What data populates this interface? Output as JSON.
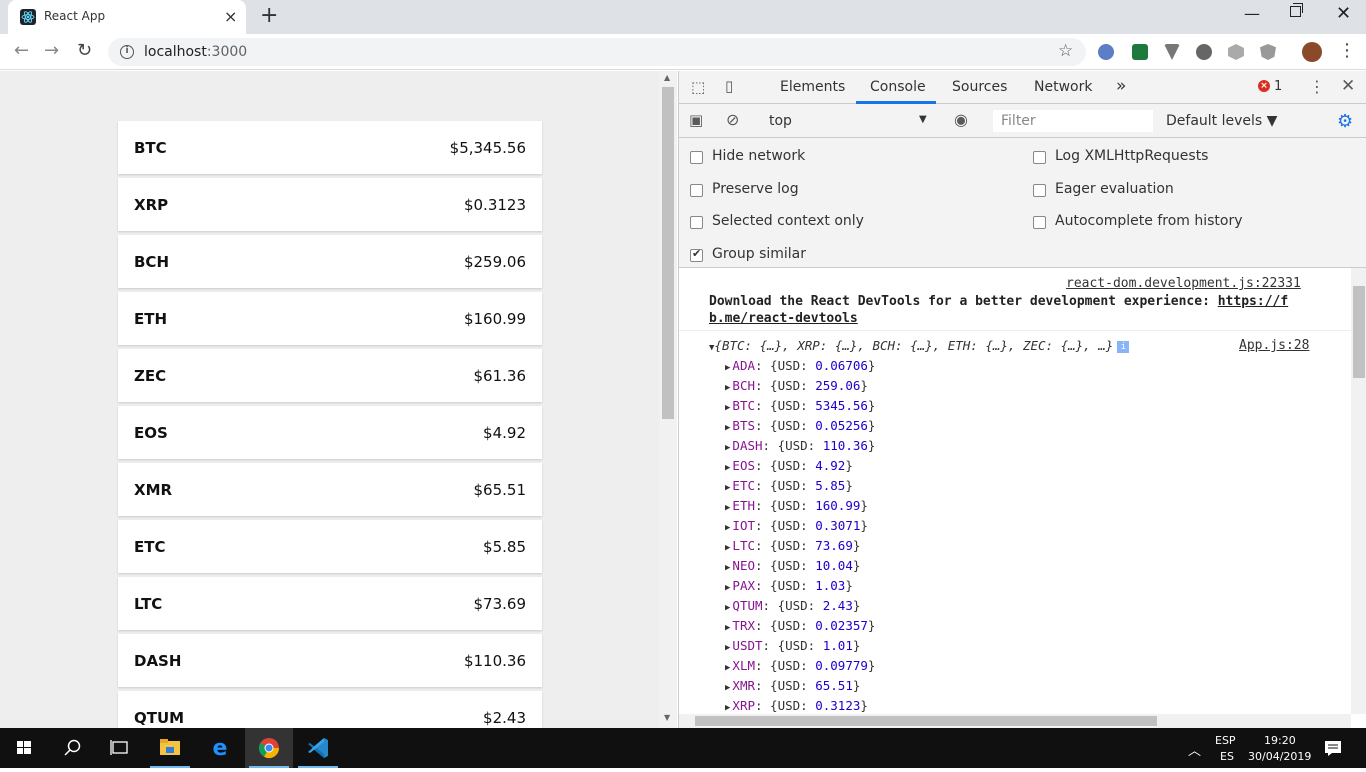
{
  "browser": {
    "tab_title": "React App",
    "tab_close": "×",
    "new_tab": "+",
    "url_host": "localhost",
    "url_port": ":3000"
  },
  "coins": [
    {
      "symbol": "BTC",
      "price": "$5,345.56"
    },
    {
      "symbol": "XRP",
      "price": "$0.3123"
    },
    {
      "symbol": "BCH",
      "price": "$259.06"
    },
    {
      "symbol": "ETH",
      "price": "$160.99"
    },
    {
      "symbol": "ZEC",
      "price": "$61.36"
    },
    {
      "symbol": "EOS",
      "price": "$4.92"
    },
    {
      "symbol": "XMR",
      "price": "$65.51"
    },
    {
      "symbol": "ETC",
      "price": "$5.85"
    },
    {
      "symbol": "LTC",
      "price": "$73.69"
    },
    {
      "symbol": "DASH",
      "price": "$110.36"
    },
    {
      "symbol": "QTUM",
      "price": "$2.43"
    }
  ],
  "devtools": {
    "tabs": [
      "Elements",
      "Console",
      "Sources",
      "Network"
    ],
    "more_tabs": "»",
    "error_count": "1",
    "context": "top",
    "filter_placeholder": "Filter",
    "levels": "Default levels ▼",
    "options_left": [
      {
        "label": "Hide network",
        "checked": false
      },
      {
        "label": "Preserve log",
        "checked": false
      },
      {
        "label": "Selected context only",
        "checked": false
      },
      {
        "label": "Group similar",
        "checked": true
      }
    ],
    "options_right": [
      {
        "label": "Log XMLHttpRequests",
        "checked": false
      },
      {
        "label": "Eager evaluation",
        "checked": false
      },
      {
        "label": "Autocomplete from history",
        "checked": false
      }
    ],
    "console": {
      "msg1_source": "react-dom.development.js:22331",
      "msg1_text": "Download the React DevTools for a better development experience: ",
      "msg1_link_a": "https://f",
      "msg1_link_b": "b.me/react-devtools",
      "obj_source": "App.js:28",
      "obj_summary": "{BTC: {…}, XRP: {…}, BCH: {…}, ETH: {…}, ZEC: {…}, …}",
      "entries": [
        {
          "key": "ADA",
          "val": "0.06706"
        },
        {
          "key": "BCH",
          "val": "259.06"
        },
        {
          "key": "BTC",
          "val": "5345.56"
        },
        {
          "key": "BTS",
          "val": "0.05256"
        },
        {
          "key": "DASH",
          "val": "110.36"
        },
        {
          "key": "EOS",
          "val": "4.92"
        },
        {
          "key": "ETC",
          "val": "5.85"
        },
        {
          "key": "ETH",
          "val": "160.99"
        },
        {
          "key": "IOT",
          "val": "0.3071"
        },
        {
          "key": "LTC",
          "val": "73.69"
        },
        {
          "key": "NEO",
          "val": "10.04"
        },
        {
          "key": "PAX",
          "val": "1.03"
        },
        {
          "key": "QTUM",
          "val": "2.43"
        },
        {
          "key": "TRX",
          "val": "0.02357"
        },
        {
          "key": "USDT",
          "val": "1.01"
        },
        {
          "key": "XLM",
          "val": "0.09779"
        },
        {
          "key": "XMR",
          "val": "65.51"
        },
        {
          "key": "XRP",
          "val": "0.3123"
        }
      ]
    }
  },
  "taskbar": {
    "lang_top": "ESP",
    "lang_bottom": "ES",
    "time": "19:20",
    "date": "30/04/2019"
  },
  "colors": {
    "accent": "#1a73e8",
    "key": "#881391",
    "number": "#1c00cf"
  }
}
